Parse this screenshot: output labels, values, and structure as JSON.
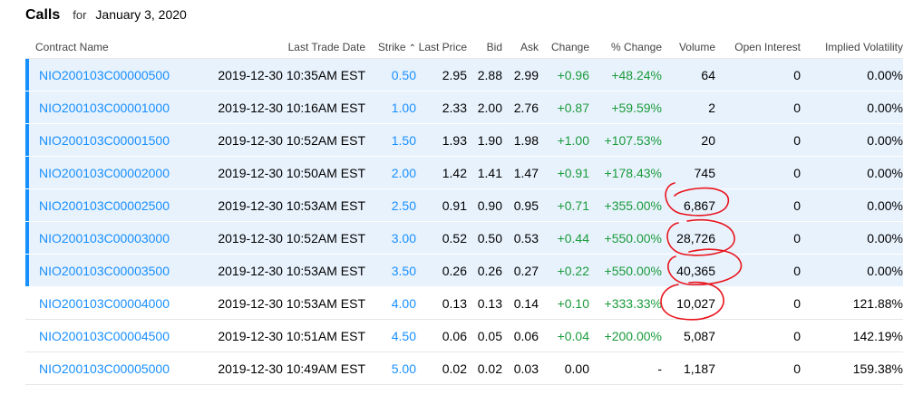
{
  "header": {
    "title": "Calls",
    "for_label": "for",
    "date": "January 3, 2020"
  },
  "columns": [
    "Contract Name",
    "Last Trade Date",
    "Strike",
    "Last Price",
    "Bid",
    "Ask",
    "Change",
    "% Change",
    "Volume",
    "Open Interest",
    "Implied Volatility"
  ],
  "icons": {
    "sort": "sort-ascending-icon"
  },
  "colors": {
    "link": "#188fff",
    "positive": "#1a9b3b",
    "in_the_money_row": "#e8f2fd",
    "annotation": "#e8141c"
  },
  "rows": [
    {
      "contract": "NIO200103C00000500",
      "last_trade": "2019-12-30 10:35AM EST",
      "strike": "0.50",
      "last_price": "2.95",
      "bid": "2.88",
      "ask": "2.99",
      "change": "+0.96",
      "pct_change": "+48.24%",
      "volume": "64",
      "open_interest": "0",
      "iv": "0.00%",
      "itm": true
    },
    {
      "contract": "NIO200103C00001000",
      "last_trade": "2019-12-30 10:16AM EST",
      "strike": "1.00",
      "last_price": "2.33",
      "bid": "2.00",
      "ask": "2.76",
      "change": "+0.87",
      "pct_change": "+59.59%",
      "volume": "2",
      "open_interest": "0",
      "iv": "0.00%",
      "itm": true
    },
    {
      "contract": "NIO200103C00001500",
      "last_trade": "2019-12-30 10:52AM EST",
      "strike": "1.50",
      "last_price": "1.93",
      "bid": "1.90",
      "ask": "1.98",
      "change": "+1.00",
      "pct_change": "+107.53%",
      "volume": "20",
      "open_interest": "0",
      "iv": "0.00%",
      "itm": true
    },
    {
      "contract": "NIO200103C00002000",
      "last_trade": "2019-12-30 10:50AM EST",
      "strike": "2.00",
      "last_price": "1.42",
      "bid": "1.41",
      "ask": "1.47",
      "change": "+0.91",
      "pct_change": "+178.43%",
      "volume": "745",
      "open_interest": "0",
      "iv": "0.00%",
      "itm": true
    },
    {
      "contract": "NIO200103C00002500",
      "last_trade": "2019-12-30 10:53AM EST",
      "strike": "2.50",
      "last_price": "0.91",
      "bid": "0.90",
      "ask": "0.95",
      "change": "+0.71",
      "pct_change": "+355.00%",
      "volume": "6,867",
      "open_interest": "0",
      "iv": "0.00%",
      "itm": true
    },
    {
      "contract": "NIO200103C00003000",
      "last_trade": "2019-12-30 10:52AM EST",
      "strike": "3.00",
      "last_price": "0.52",
      "bid": "0.50",
      "ask": "0.53",
      "change": "+0.44",
      "pct_change": "+550.00%",
      "volume": "28,726",
      "open_interest": "0",
      "iv": "0.00%",
      "itm": true
    },
    {
      "contract": "NIO200103C00003500",
      "last_trade": "2019-12-30 10:53AM EST",
      "strike": "3.50",
      "last_price": "0.26",
      "bid": "0.26",
      "ask": "0.27",
      "change": "+0.22",
      "pct_change": "+550.00%",
      "volume": "40,365",
      "open_interest": "0",
      "iv": "0.00%",
      "itm": true
    },
    {
      "contract": "NIO200103C00004000",
      "last_trade": "2019-12-30 10:53AM EST",
      "strike": "4.00",
      "last_price": "0.13",
      "bid": "0.13",
      "ask": "0.14",
      "change": "+0.10",
      "pct_change": "+333.33%",
      "volume": "10,027",
      "open_interest": "0",
      "iv": "121.88%",
      "itm": false
    },
    {
      "contract": "NIO200103C00004500",
      "last_trade": "2019-12-30 10:51AM EST",
      "strike": "4.50",
      "last_price": "0.06",
      "bid": "0.05",
      "ask": "0.06",
      "change": "+0.04",
      "pct_change": "+200.00%",
      "volume": "5,087",
      "open_interest": "0",
      "iv": "142.19%",
      "itm": false
    },
    {
      "contract": "NIO200103C00005000",
      "last_trade": "2019-12-30 10:49AM EST",
      "strike": "5.00",
      "last_price": "0.02",
      "bid": "0.02",
      "ask": "0.03",
      "change": "0.00",
      "pct_change": "-",
      "volume": "1,187",
      "open_interest": "0",
      "iv": "159.38%",
      "itm": false
    }
  ]
}
